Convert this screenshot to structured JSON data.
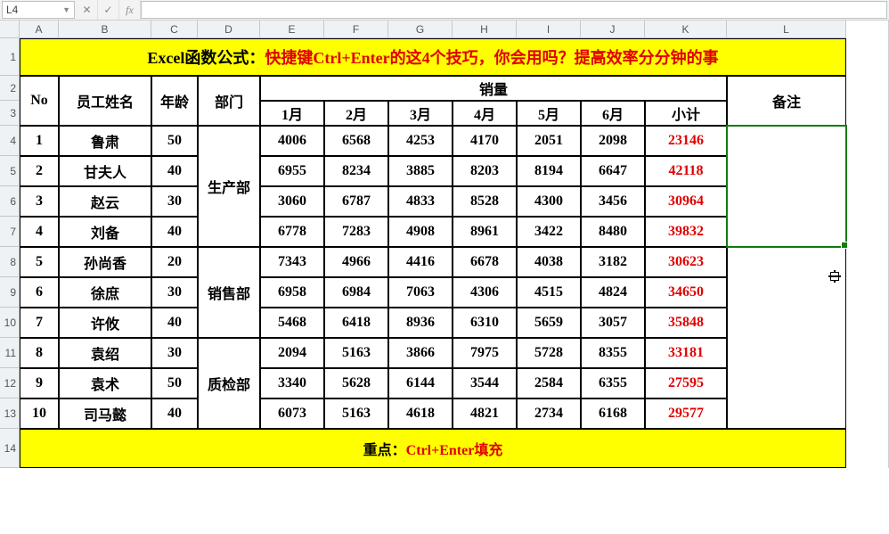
{
  "namebox": {
    "ref": "L4"
  },
  "fbarIcons": {
    "cancel": "✕",
    "confirm": "✓",
    "fx": "fx"
  },
  "columns": [
    "A",
    "B",
    "C",
    "D",
    "E",
    "F",
    "G",
    "H",
    "I",
    "J",
    "K",
    "L"
  ],
  "rows": [
    "1",
    "2",
    "3",
    "4",
    "5",
    "6",
    "7",
    "8",
    "9",
    "10",
    "11",
    "12",
    "13",
    "14"
  ],
  "title": {
    "black": "Excel函数公式：",
    "red": "快捷键Ctrl+Enter的这4个技巧，你会用吗？提高效率分分钟的事"
  },
  "headers": {
    "no": "No",
    "name": "员工姓名",
    "age": "年龄",
    "dept": "部门",
    "salesGroup": "销量",
    "months": [
      "1月",
      "2月",
      "3月",
      "4月",
      "5月",
      "6月"
    ],
    "subtotal": "小计",
    "remark": "备注"
  },
  "depts": [
    "生产部",
    "销售部",
    "质检部"
  ],
  "rowsData": [
    {
      "no": "1",
      "name": "鲁肃",
      "age": "50",
      "m": [
        "4006",
        "6568",
        "4253",
        "4170",
        "2051",
        "2098"
      ],
      "sub": "23146"
    },
    {
      "no": "2",
      "name": "甘夫人",
      "age": "40",
      "m": [
        "6955",
        "8234",
        "3885",
        "8203",
        "8194",
        "6647"
      ],
      "sub": "42118"
    },
    {
      "no": "3",
      "name": "赵云",
      "age": "30",
      "m": [
        "3060",
        "6787",
        "4833",
        "8528",
        "4300",
        "3456"
      ],
      "sub": "30964"
    },
    {
      "no": "4",
      "name": "刘备",
      "age": "40",
      "m": [
        "6778",
        "7283",
        "4908",
        "8961",
        "3422",
        "8480"
      ],
      "sub": "39832"
    },
    {
      "no": "5",
      "name": "孙尚香",
      "age": "20",
      "m": [
        "7343",
        "4966",
        "4416",
        "6678",
        "4038",
        "3182"
      ],
      "sub": "30623"
    },
    {
      "no": "6",
      "name": "徐庶",
      "age": "30",
      "m": [
        "6958",
        "6984",
        "7063",
        "4306",
        "4515",
        "4824"
      ],
      "sub": "34650"
    },
    {
      "no": "7",
      "name": "许攸",
      "age": "40",
      "m": [
        "5468",
        "6418",
        "8936",
        "6310",
        "5659",
        "3057"
      ],
      "sub": "35848"
    },
    {
      "no": "8",
      "name": "袁绍",
      "age": "30",
      "m": [
        "2094",
        "5163",
        "3866",
        "7975",
        "5728",
        "8355"
      ],
      "sub": "33181"
    },
    {
      "no": "9",
      "name": "袁术",
      "age": "50",
      "m": [
        "3340",
        "5628",
        "6144",
        "3544",
        "2584",
        "6355"
      ],
      "sub": "27595"
    },
    {
      "no": "10",
      "name": "司马懿",
      "age": "40",
      "m": [
        "6073",
        "5163",
        "4618",
        "4821",
        "2734",
        "6168"
      ],
      "sub": "29577"
    }
  ],
  "footer": {
    "black": "重点：",
    "red": "Ctrl+Enter填充"
  },
  "selectedCell": "L4"
}
